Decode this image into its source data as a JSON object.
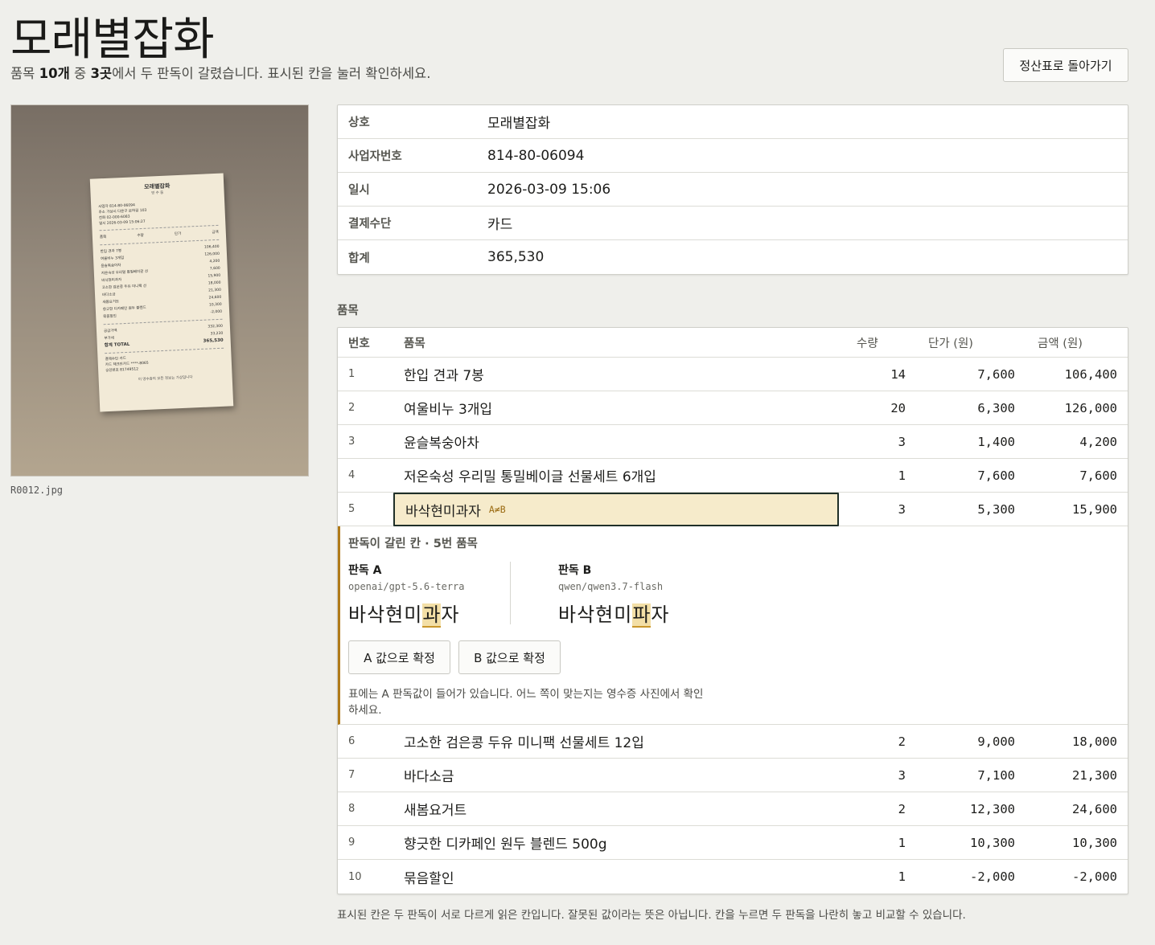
{
  "header": {
    "title": "모래별잡화",
    "subtitle_prefix": "품목 ",
    "subtitle_count": "10개",
    "subtitle_mid": " 중 ",
    "subtitle_flagged": "3곳",
    "subtitle_suffix": "에서 두 판독이 갈렸습니다. 표시된 칸을 눌러 확인하세요.",
    "back_button": "정산표로 돌아가기"
  },
  "photo": {
    "caption": "R0012.jpg",
    "receipt": {
      "title": "모래별잡화",
      "subtitle": "영 수 증",
      "lines": [
        "사업자 814-80-06094",
        "주소 가상시 다온구 은하길 103",
        "전화 02-000-6083",
        "일시 2026-03-09 15:06:27"
      ],
      "col_header": [
        "품목",
        "수량",
        "단가",
        "금액"
      ],
      "supply": "공급가액",
      "supply_value": "332,300",
      "vat": "부가세",
      "vat_value": "33,230",
      "total": "합계 TOTAL",
      "total_value": "365,530",
      "pay_lines": [
        "결제수단 카드",
        "카드 체크트카드 ****-8065",
        "승인번호 81749512"
      ],
      "footer": "이 영수증의 모든 정보는 가상입니다"
    }
  },
  "info": [
    {
      "label": "상호",
      "value": "모래별잡화"
    },
    {
      "label": "사업자번호",
      "value": "814-80-06094"
    },
    {
      "label": "일시",
      "value": "2026-03-09 15:06"
    },
    {
      "label": "결제수단",
      "value": "카드"
    },
    {
      "label": "합계",
      "value": "365,530"
    }
  ],
  "items_section_label": "품목",
  "items_header": {
    "no": "번호",
    "name": "품목",
    "qty": "수량",
    "unit": "단가 (원)",
    "amount": "금액 (원)"
  },
  "items": [
    {
      "no": "1",
      "name": "한입 견과 7봉",
      "qty": "14",
      "unit": "7,600",
      "amount": "106,400"
    },
    {
      "no": "2",
      "name": "여울비누 3개입",
      "qty": "20",
      "unit": "6,300",
      "amount": "126,000"
    },
    {
      "no": "3",
      "name": "윤슬복숭아차",
      "qty": "3",
      "unit": "1,400",
      "amount": "4,200"
    },
    {
      "no": "4",
      "name": "저온숙성 우리밀 통밀베이글 선물세트 6개입",
      "qty": "1",
      "unit": "7,600",
      "amount": "7,600"
    },
    {
      "no": "5",
      "name": "바삭현미과자",
      "flag": "A≠B",
      "qty": "3",
      "unit": "5,300",
      "amount": "15,900"
    },
    {
      "no": "6",
      "name": "고소한 검은콩 두유 미니팩 선물세트 12입",
      "qty": "2",
      "unit": "9,000",
      "amount": "18,000"
    },
    {
      "no": "7",
      "name": "바다소금",
      "qty": "3",
      "unit": "7,100",
      "amount": "21,300"
    },
    {
      "no": "8",
      "name": "새봄요거트",
      "qty": "2",
      "unit": "12,300",
      "amount": "24,600"
    },
    {
      "no": "9",
      "name": "향긋한 디카페인 원두 블렌드 500g",
      "qty": "1",
      "unit": "10,300",
      "amount": "10,300"
    },
    {
      "no": "10",
      "name": "묶음할인",
      "qty": "1",
      "unit": "-2,000",
      "amount": "-2,000"
    }
  ],
  "disagreement": {
    "title": "판독이 갈린 칸 · 5번 품목",
    "judge_a": {
      "label": "판독 A",
      "model": "openai/gpt-5.6-terra",
      "value_pre": "바삭현미",
      "value_diff": "과",
      "value_post": "자"
    },
    "judge_b": {
      "label": "판독 B",
      "model": "qwen/qwen3.7-flash",
      "value_pre": "바삭현미",
      "value_diff": "파",
      "value_post": "자"
    },
    "confirm_a": "A 값으로 확정",
    "confirm_b": "B 값으로 확정",
    "note": "표에는 A 판독값이 들어가 있습니다. 어느 쪽이 맞는지는 영수증 사진에서 확인하세요."
  },
  "footnote": "표시된 칸은 두 판독이 서로 다르게 읽은 칸입니다. 잘못된 값이라는 뜻은 아닙니다. 칸을 누르면 두 판독을 나란히 놓고 비교할 수 있습니다."
}
